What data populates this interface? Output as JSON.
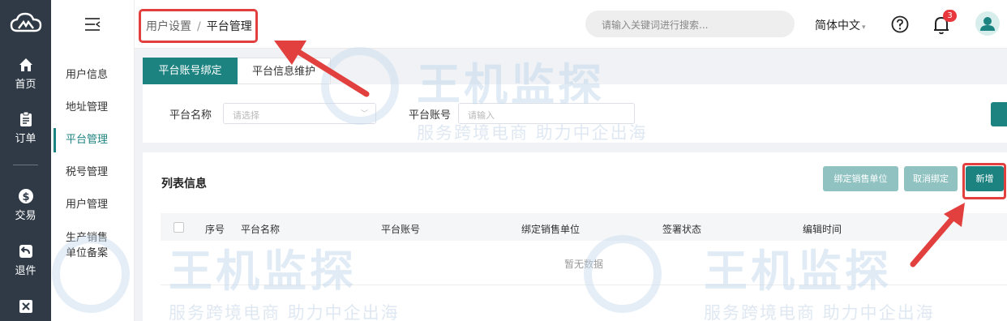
{
  "rail": {
    "items": [
      {
        "label": "首页",
        "icon": "home-icon"
      },
      {
        "label": "订单",
        "icon": "clipboard-icon"
      },
      {
        "label": "交易",
        "icon": "dollar-icon"
      },
      {
        "label": "退件",
        "icon": "return-icon"
      },
      {
        "label": "",
        "icon": "exchange-icon"
      }
    ]
  },
  "sidebar": {
    "items": [
      {
        "label": "用户信息"
      },
      {
        "label": "地址管理"
      },
      {
        "label": "平台管理"
      },
      {
        "label": "税号管理"
      },
      {
        "label": "用户管理"
      },
      {
        "label_line1": "生产销售",
        "label_line2": "单位备案"
      }
    ]
  },
  "header": {
    "breadcrumb": {
      "parent": "用户设置",
      "separator": "/",
      "current": "平台管理"
    },
    "search_placeholder": "请输入关键词进行搜索...",
    "language": "简体中文",
    "notification_count": "3"
  },
  "tabs": [
    {
      "label": "平台账号绑定"
    },
    {
      "label": "平台信息维护"
    }
  ],
  "filter": {
    "platform_name_label": "平台名称",
    "platform_name_placeholder": "请选择",
    "platform_account_label": "平台账号",
    "platform_account_placeholder": "请输入"
  },
  "list": {
    "title": "列表信息",
    "buttons": {
      "bind": "绑定销售单位",
      "unbind": "取消绑定",
      "add": "新增"
    },
    "columns": [
      "序号",
      "平台名称",
      "平台账号",
      "绑定销售单位",
      "签署状态",
      "编辑时间"
    ],
    "empty_text": "暂无数据"
  },
  "watermark": {
    "brand": "王机监探",
    "slogan": "服务跨境电商 助力中企出海"
  },
  "colors": {
    "accent": "#1d8381",
    "rail_bg": "#2f3a46",
    "highlight": "#e2403e",
    "badge": "#e8383d"
  }
}
